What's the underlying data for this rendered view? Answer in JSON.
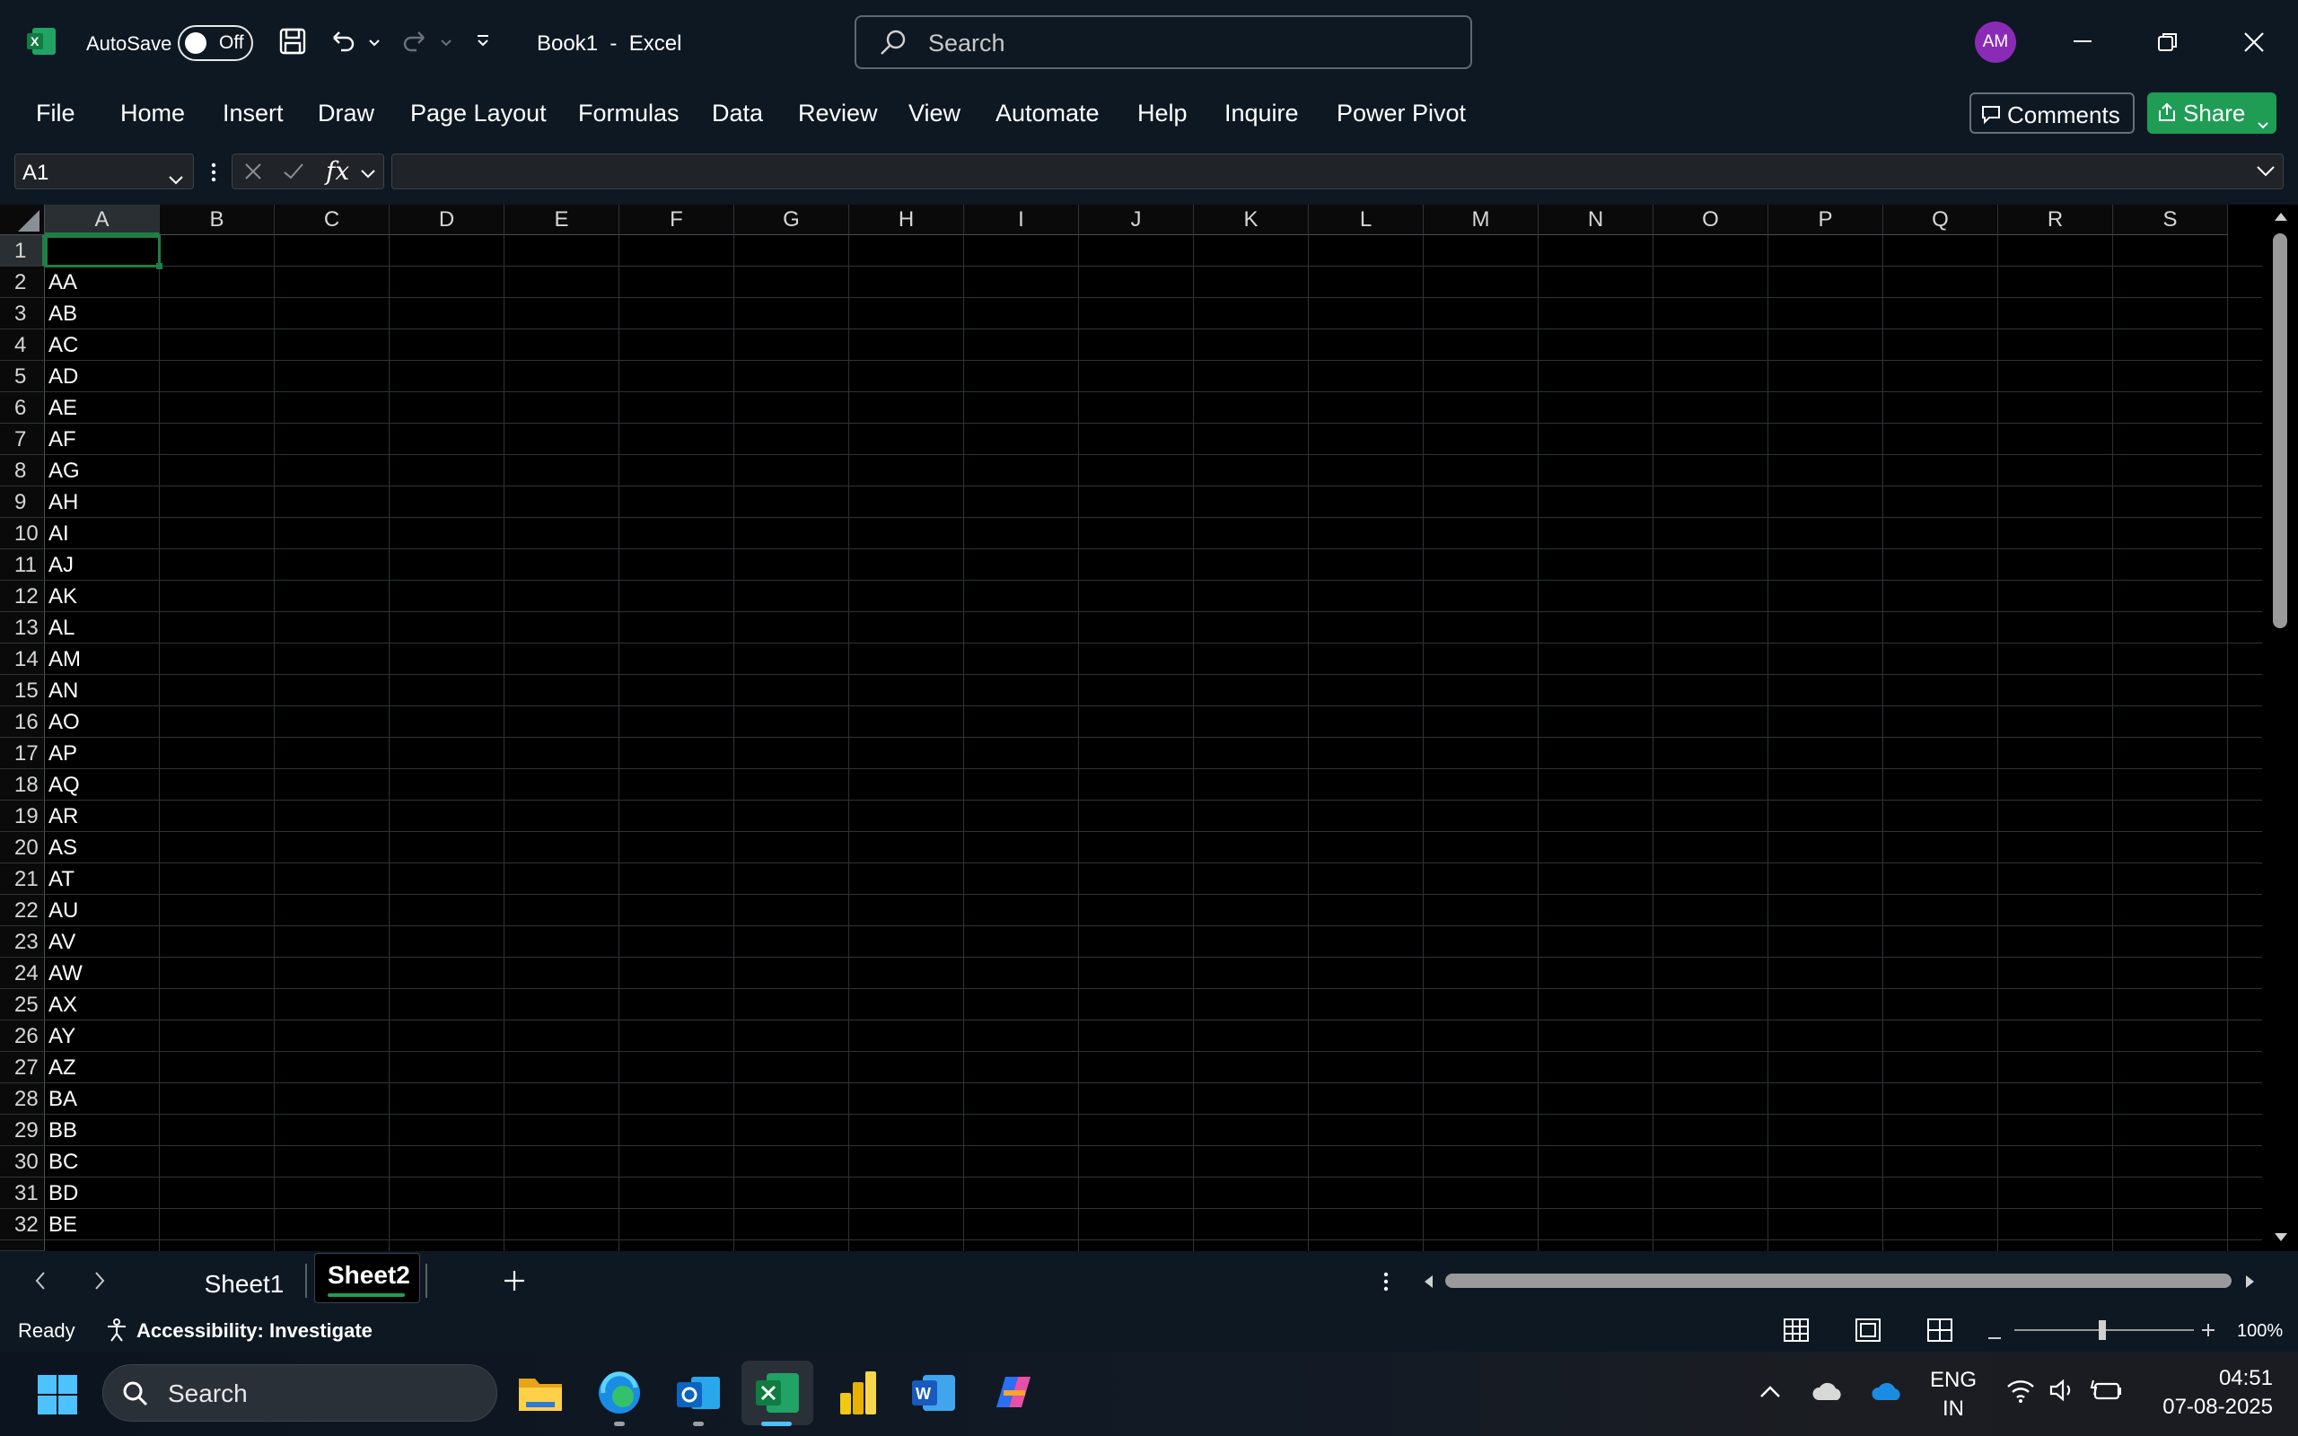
{
  "titlebar": {
    "autosave_label": "AutoSave",
    "autosave_state": "Off",
    "doc_title": "Book1  -  Excel",
    "search_placeholder": "Search",
    "avatar_initials": "AM"
  },
  "menu": {
    "items": [
      "File",
      "Home",
      "Insert",
      "Draw",
      "Page Layout",
      "Formulas",
      "Data",
      "Review",
      "View",
      "Automate",
      "Help",
      "Inquire",
      "Power Pivot"
    ],
    "comments_label": "Comments",
    "share_label": "Share"
  },
  "formula_bar": {
    "name_box": "A1",
    "fx_label": "fx",
    "formula": ""
  },
  "grid": {
    "columns": [
      "A",
      "B",
      "C",
      "D",
      "E",
      "F",
      "G",
      "H",
      "I",
      "J",
      "K",
      "L",
      "M",
      "N",
      "O",
      "P",
      "Q",
      "R",
      "S"
    ],
    "rows": [
      "1",
      "2",
      "3",
      "4",
      "5",
      "6",
      "7",
      "8",
      "9",
      "10",
      "11",
      "12",
      "13",
      "14",
      "15",
      "16",
      "17",
      "18",
      "19",
      "20",
      "21",
      "22",
      "23",
      "24",
      "25",
      "26",
      "27",
      "28",
      "29",
      "30",
      "31",
      "32"
    ],
    "column_a": [
      "",
      "AA",
      "AB",
      "AC",
      "AD",
      "AE",
      "AF",
      "AG",
      "AH",
      "AI",
      "AJ",
      "AK",
      "AL",
      "AM",
      "AN",
      "AO",
      "AP",
      "AQ",
      "AR",
      "AS",
      "AT",
      "AU",
      "AV",
      "AW",
      "AX",
      "AY",
      "AZ",
      "BA",
      "BB",
      "BC",
      "BD",
      "BE"
    ],
    "selected_cell": "A1"
  },
  "sheets": {
    "tabs": [
      "Sheet1",
      "Sheet2"
    ],
    "active": "Sheet2"
  },
  "statusbar": {
    "ready": "Ready",
    "accessibility": "Accessibility: Investigate",
    "zoom": "100%"
  },
  "taskbar": {
    "search_placeholder": "Search",
    "lang_line1": "ENG",
    "lang_line2": "IN",
    "time": "04:51",
    "date": "07-08-2025"
  },
  "colors": {
    "chrome_bg": "#0d1823",
    "grid_bg": "#000000",
    "accent_green": "#1f9d55",
    "selection_green": "#1e7e45",
    "avatar_purple": "#8a2bb6"
  }
}
